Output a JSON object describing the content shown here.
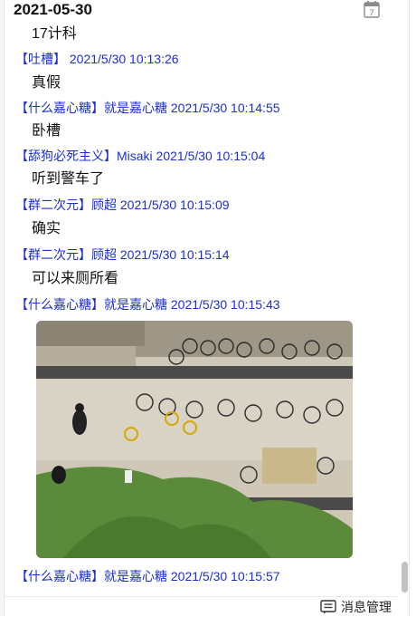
{
  "date": "2021-05-30",
  "messages": [
    {
      "text": "17计科"
    },
    {
      "header": "【吐槽】 2021/5/30 10:13:26",
      "text": "真假"
    },
    {
      "header": "【什么嘉心糖】就是嘉心糖 2021/5/30 10:14:55",
      "text": "卧槽"
    },
    {
      "header": "【舔狗必死主义】Misaki 2021/5/30 10:15:04",
      "text": "听到警车了"
    },
    {
      "header": "【群二次元】顾超 2021/5/30 10:15:09",
      "text": "确实"
    },
    {
      "header": "【群二次元】顾超 2021/5/30 10:15:14",
      "text": "可以来厕所看"
    },
    {
      "header": "【什么嘉心糖】就是嘉心糖 2021/5/30 10:15:43",
      "image": "photo-of-parked-bicycles-from-window"
    },
    {
      "header": "【什么嘉心糖】就是嘉心糖 2021/5/30 10:15:57"
    }
  ],
  "footer": {
    "manage_label": "消息管理",
    "manage_icon": "message-manage-icon"
  },
  "icons": {
    "calendar": "calendar-icon"
  },
  "colors": {
    "header_blue": "#1a2fcc",
    "text": "#111111",
    "scroll_thumb": "#c1c1c1"
  }
}
